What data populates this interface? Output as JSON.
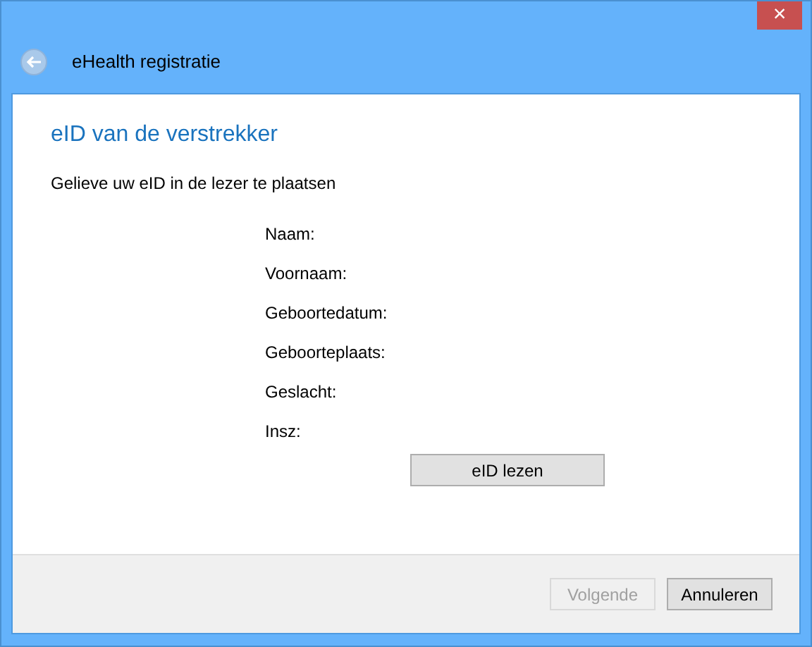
{
  "window": {
    "title": "eHealth registratie",
    "close": "×"
  },
  "page": {
    "heading": "eID van de verstrekker",
    "instruction": "Gelieve uw eID in de lezer te plaatsen",
    "fields": [
      {
        "label": "Naam:"
      },
      {
        "label": "Voornaam:"
      },
      {
        "label": "Geboortedatum:"
      },
      {
        "label": "Geboorteplaats:"
      },
      {
        "label": "Geslacht:"
      },
      {
        "label": "Insz:"
      }
    ],
    "read_button": {
      "label": "eID lezen",
      "disabled": false
    }
  },
  "footer": {
    "buttons": [
      {
        "label": "Volgende",
        "disabled": true
      },
      {
        "label": "Annuleren",
        "disabled": false
      }
    ]
  }
}
